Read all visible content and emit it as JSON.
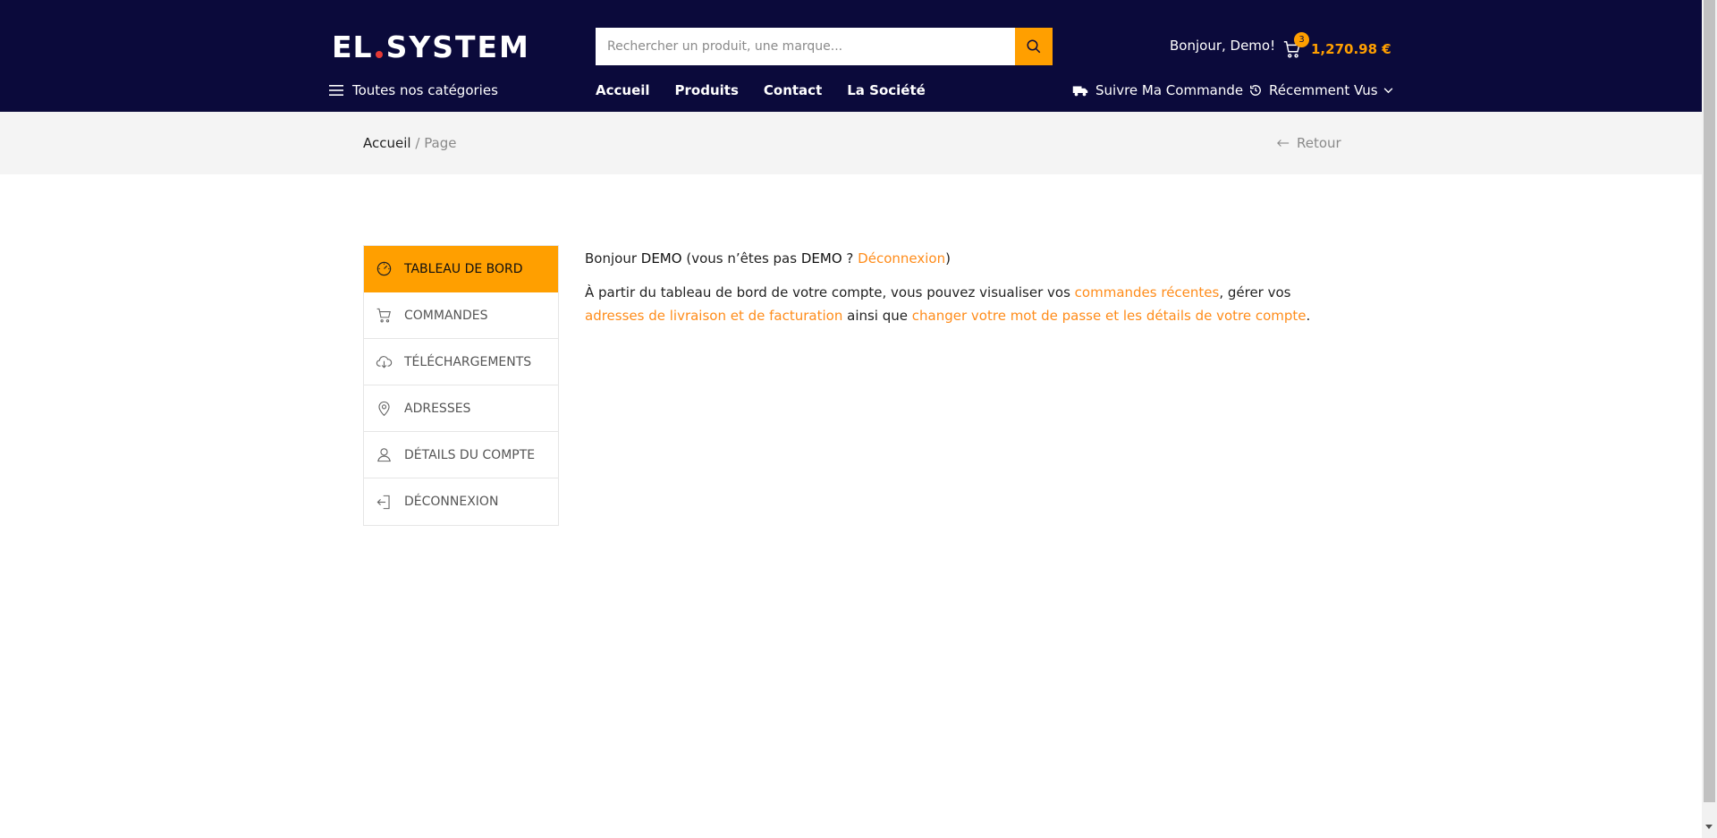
{
  "header": {
    "logo": {
      "part1": "EL",
      "part2": "SYSTEM"
    },
    "search": {
      "placeholder": "Rechercher un produit, une marque..."
    },
    "greeting": "Bonjour, Demo!",
    "cart": {
      "count": "3",
      "total": "1,270.98 €"
    },
    "categories_label": "Toutes nos catégories",
    "nav": [
      "Accueil",
      "Produits",
      "Contact",
      "La Société"
    ],
    "track_label": "Suivre Ma Commande",
    "recent_label": "Récemment Vus"
  },
  "breadcrumb": {
    "home": "Accueil",
    "separator": "/",
    "current": "Page",
    "back": "Retour"
  },
  "sidebar": {
    "items": [
      {
        "label": "TABLEAU DE BORD",
        "icon": "dashboard-icon"
      },
      {
        "label": "COMMANDES",
        "icon": "cart-icon"
      },
      {
        "label": "TÉLÉCHARGEMENTS",
        "icon": "cloud-download-icon"
      },
      {
        "label": "ADRESSES",
        "icon": "location-pin-icon"
      },
      {
        "label": "DÉTAILS DU COMPTE",
        "icon": "user-icon"
      },
      {
        "label": "DÉCONNEXION",
        "icon": "logout-icon"
      }
    ]
  },
  "content": {
    "greeting_prefix": "Bonjour",
    "user": "DEMO",
    "not_user_open": "(vous n’êtes pas",
    "not_user_q": "?",
    "logout_link": "Déconnexion",
    "close_paren": ")",
    "para_intro": "À partir du tableau de bord de votre compte, vous pouvez visualiser vos",
    "link_orders": "commandes récentes",
    "para_mid1": ", gérer vos",
    "link_addresses": "adresses de livraison et de facturation",
    "para_mid2": "ainsi que",
    "link_account": "changer votre mot de passe et les détails de votre compte",
    "para_end": "."
  },
  "colors": {
    "header_bg": "#0b0a3b",
    "accent": "#ff9f00",
    "link": "#ff8c1a"
  }
}
